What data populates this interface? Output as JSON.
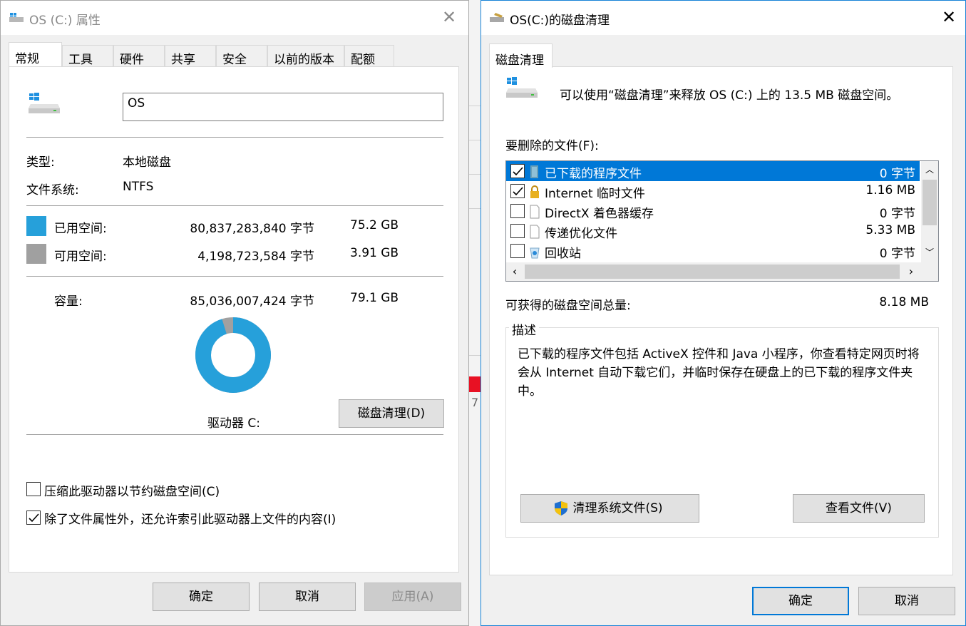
{
  "properties_window": {
    "title": "OS (C:) 属性",
    "tabs": [
      "常规",
      "工具",
      "硬件",
      "共享",
      "安全",
      "以前的版本",
      "配额"
    ],
    "drive_name": "OS",
    "type_label": "类型:",
    "type_value": "本地磁盘",
    "fs_label": "文件系统:",
    "fs_value": "NTFS",
    "used_label": "已用空间:",
    "used_bytes": "80,837,283,840 字节",
    "used_size": "75.2 GB",
    "free_label": "可用空间:",
    "free_bytes": "4,198,723,584 字节",
    "free_size": "3.91 GB",
    "capacity_label": "容量:",
    "capacity_bytes": "85,036,007,424 字节",
    "capacity_size": "79.1 GB",
    "drive_label": "驱动器 C:",
    "disk_cleanup_button": "磁盘清理(D)",
    "compress_option": "压缩此驱动器以节约磁盘空间(C)",
    "compress_checked": false,
    "index_option": "除了文件属性外，还允许索引此驱动器上文件的内容(I)",
    "index_checked": true,
    "ok_button": "确定",
    "cancel_button": "取消",
    "apply_button": "应用(A)",
    "used_fraction": 0.9506,
    "colors": {
      "used": "#26a0da",
      "free": "#a0a0a0"
    }
  },
  "cleanup_window": {
    "title": "OS(C:)的磁盘清理",
    "tab": "磁盘清理",
    "intro_text": "可以使用“磁盘清理”来释放 OS (C:) 上的 13.5 MB 磁盘空间。",
    "files_to_delete_label": "要删除的文件(F):",
    "files": [
      {
        "name": "已下载的程序文件",
        "size": "0 字节",
        "checked": true,
        "selected": true,
        "icon": "folder-icon"
      },
      {
        "name": "Internet 临时文件",
        "size": "1.16 MB",
        "checked": true,
        "selected": false,
        "icon": "lock-icon"
      },
      {
        "name": "DirectX 着色器缓存",
        "size": "0 字节",
        "checked": false,
        "selected": false,
        "icon": "file-icon"
      },
      {
        "name": "传递优化文件",
        "size": "5.33 MB",
        "checked": false,
        "selected": false,
        "icon": "file-icon"
      },
      {
        "name": "回收站",
        "size": "0 字节",
        "checked": false,
        "selected": false,
        "icon": "recycle-bin-icon"
      }
    ],
    "total_label": "可获得的磁盘空间总量:",
    "total_value": "8.18 MB",
    "description_title": "描述",
    "description_text": "已下载的程序文件包括 ActiveX 控件和 Java 小程序，你查看特定网页时将会从 Internet 自动下载它们，并临时保存在硬盘上的已下载的程序文件夹中。",
    "clean_system_button": "清理系统文件(S)",
    "view_files_button": "查看文件(V)",
    "ok_button": "确定",
    "cancel_button": "取消",
    "colors": {
      "selection": "#0078d7",
      "accent_border": "#1883d7"
    }
  }
}
